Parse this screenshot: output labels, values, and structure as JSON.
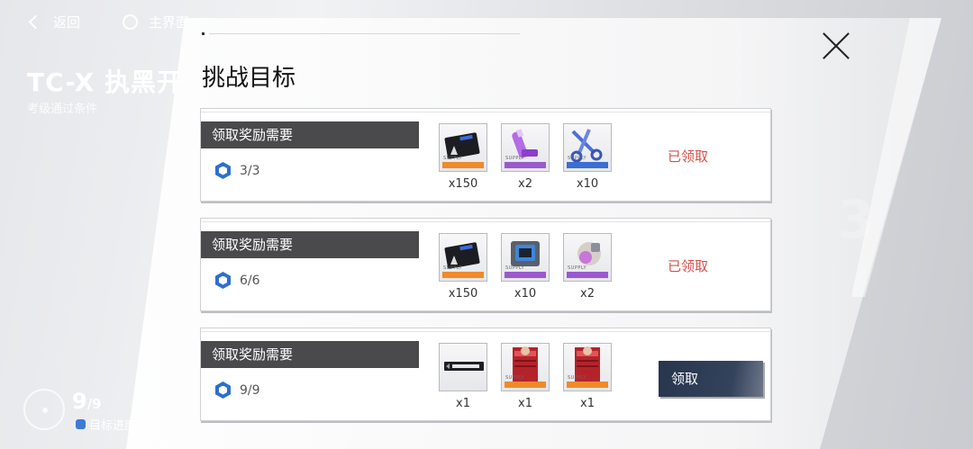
{
  "nav": {
    "back_label": "返回",
    "home_label": "主界面"
  },
  "stage": {
    "title": "TC-X 执黑开",
    "subtitle": "考级通过条件",
    "bg_digit": "3"
  },
  "progress": {
    "current": "9",
    "total": "/9",
    "label": "目标进度"
  },
  "dialog": {
    "title": "挑战目标",
    "close_icon": "close-icon",
    "cards": [
      {
        "label": "领取奖励需要",
        "progress": "3/3",
        "status": "已领取",
        "rewards": [
          {
            "icon": "card-ticket-icon",
            "qty": "x150",
            "rarity_color": "#f08a2a"
          },
          {
            "icon": "purple-tube-icon",
            "qty": "x2",
            "rarity_color": "#9b59d0"
          },
          {
            "icon": "scissors-tool-icon",
            "qty": "x10",
            "rarity_color": "#3b6ed2"
          }
        ]
      },
      {
        "label": "领取奖励需要",
        "progress": "6/6",
        "status": "已领取",
        "rewards": [
          {
            "icon": "card-ticket-icon",
            "qty": "x150",
            "rarity_color": "#f08a2a"
          },
          {
            "icon": "chip-module-icon",
            "qty": "x10",
            "rarity_color": "#9b59d0"
          },
          {
            "icon": "orb-device-icon",
            "qty": "x2",
            "rarity_color": "#9b59d0"
          }
        ]
      },
      {
        "label": "领取奖励需要",
        "progress": "9/9",
        "status": "",
        "button": "领取",
        "rewards": [
          {
            "icon": "nameplate-icon",
            "qty": "x1",
            "rarity_color": ""
          },
          {
            "icon": "red-card-icon",
            "qty": "x1",
            "rarity_color": "#f08a2a"
          },
          {
            "icon": "red-card-icon",
            "qty": "x1",
            "rarity_color": "#f08a2a"
          }
        ]
      }
    ]
  },
  "colors": {
    "claimed_text": "#d4504a",
    "label_bg": "#4a4a4c",
    "claim_button_bg": "#27354d",
    "hex_blue": "#2d6fd1"
  }
}
